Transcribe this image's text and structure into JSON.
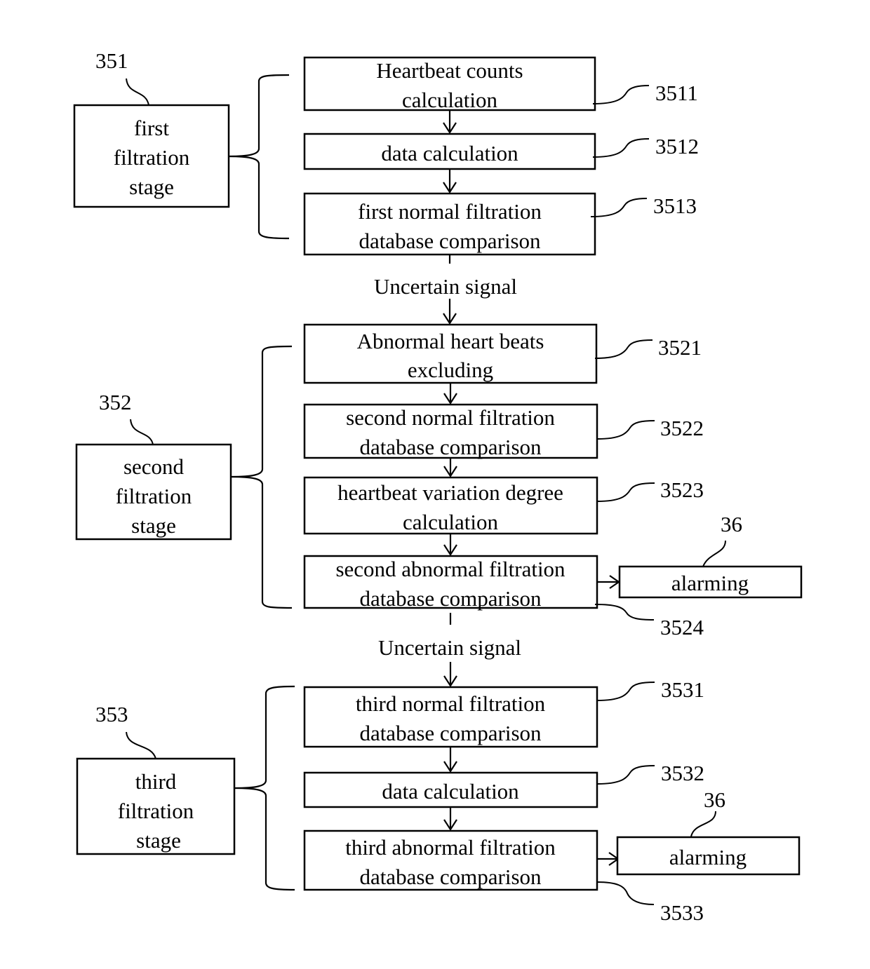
{
  "figure": {
    "stages": [
      {
        "ref": "351",
        "label_lines": [
          "first",
          "filtration",
          "stage"
        ],
        "steps": [
          {
            "ref": "3511",
            "lines": [
              "Heartbeat counts",
              "calculation"
            ]
          },
          {
            "ref": "3512",
            "lines": [
              "data calculation"
            ]
          },
          {
            "ref": "3513",
            "lines": [
              "first normal filtration",
              "database comparison"
            ]
          }
        ]
      },
      {
        "ref": "352",
        "label_lines": [
          "second",
          "filtration",
          "stage"
        ],
        "steps": [
          {
            "ref": "3521",
            "lines": [
              "Abnormal heart beats",
              "excluding"
            ]
          },
          {
            "ref": "3522",
            "lines": [
              "second normal filtration",
              "database comparison"
            ]
          },
          {
            "ref": "3523",
            "lines": [
              "heartbeat variation degree",
              "calculation"
            ]
          },
          {
            "ref": "3524",
            "lines": [
              "second abnormal filtration",
              "database comparison"
            ]
          }
        ],
        "alarm": {
          "ref": "36",
          "label": "alarming"
        }
      },
      {
        "ref": "353",
        "label_lines": [
          "third",
          "filtration",
          "stage"
        ],
        "steps": [
          {
            "ref": "3531",
            "lines": [
              "third normal filtration",
              "database comparison"
            ]
          },
          {
            "ref": "3532",
            "lines": [
              "data calculation"
            ]
          },
          {
            "ref": "3533",
            "lines": [
              "third abnormal filtration",
              "database comparison"
            ]
          }
        ],
        "alarm": {
          "ref": "36",
          "label": "alarming"
        }
      }
    ],
    "transitions": [
      {
        "label": "Uncertain signal"
      },
      {
        "label": "Uncertain signal"
      }
    ],
    "colors": {
      "stroke": "#000000",
      "background": "#ffffff"
    }
  }
}
